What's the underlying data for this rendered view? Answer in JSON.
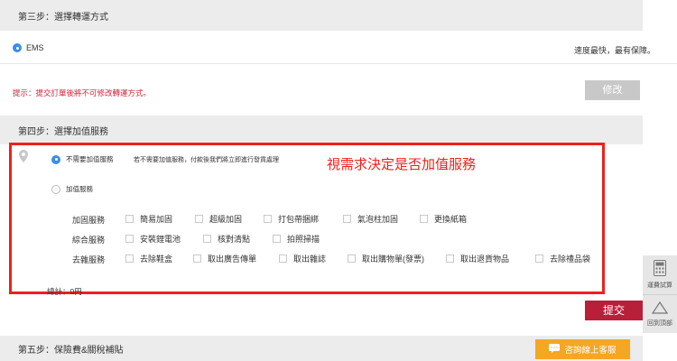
{
  "step3": {
    "title": "第三步：選擇轉運方式",
    "option_label": "EMS",
    "option_note": "速度最快，最有保障。",
    "hint": "提示：提交訂單後將不可修改轉運方式。",
    "edit_button": "修改"
  },
  "step4": {
    "title": "第四步：選擇加值服務",
    "no_service_label": "不需要加值服務",
    "no_service_desc": "若不需要加值服務，付款後我們將立即進行發貨處理",
    "annotation": "視需求決定是否加值服務",
    "with_service_label": "加值服務",
    "groups": [
      {
        "label": "加固服務",
        "items": [
          "簡易加固",
          "超級加固",
          "打包帶捆綁",
          "氣泡柱加固",
          "更換紙箱"
        ]
      },
      {
        "label": "綜合服務",
        "items": [
          "安裝鋰電池",
          "核對清點",
          "拍照掃描"
        ]
      },
      {
        "label": "去雜服務",
        "items": [
          "去除鞋盒",
          "取出廣告傳單",
          "取出雜誌",
          "取出購物單(發票)",
          "取出退貨物品",
          "去除禮品袋"
        ]
      }
    ],
    "total": "總計：0円",
    "submit_button": "提交"
  },
  "step5": {
    "title": "第五步：保險費&關稅補貼"
  },
  "chat_button": "咨詢線上客服",
  "side": {
    "calc_label": "運費試算",
    "top_label": "回到頂部"
  },
  "colors": {
    "accent_blue": "#3a8ee6",
    "annotation_red": "#f0201a",
    "submit_red": "#b8203a",
    "chat_orange": "#f5a623"
  }
}
